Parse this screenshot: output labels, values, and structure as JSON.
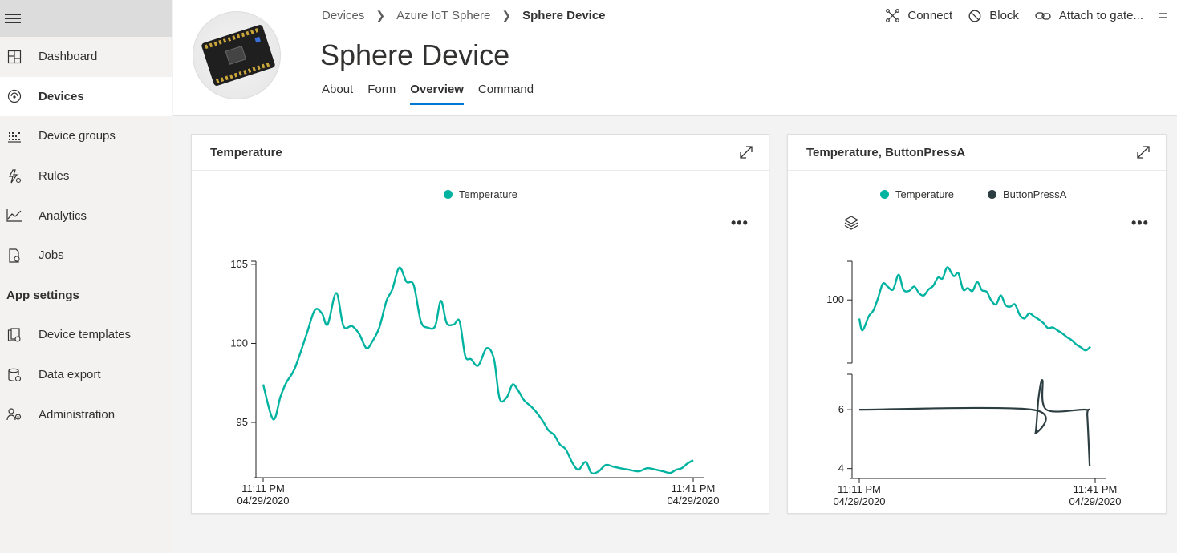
{
  "sidebar": {
    "items": [
      {
        "label": "Dashboard",
        "icon": "dashboard-icon"
      },
      {
        "label": "Devices",
        "icon": "devices-icon",
        "active": true
      },
      {
        "label": "Device groups",
        "icon": "device-groups-icon"
      },
      {
        "label": "Rules",
        "icon": "rules-icon"
      },
      {
        "label": "Analytics",
        "icon": "analytics-icon"
      },
      {
        "label": "Jobs",
        "icon": "jobs-icon"
      }
    ],
    "section_label": "App settings",
    "settings_items": [
      {
        "label": "Device templates",
        "icon": "device-templates-icon"
      },
      {
        "label": "Data export",
        "icon": "data-export-icon"
      },
      {
        "label": "Administration",
        "icon": "administration-icon"
      }
    ]
  },
  "header": {
    "breadcrumb": [
      "Devices",
      "Azure IoT Sphere",
      "Sphere Device"
    ],
    "title": "Sphere Device",
    "tabs": [
      "About",
      "Form",
      "Overview",
      "Command"
    ],
    "active_tab": "Overview",
    "toolbar": {
      "connect_label": "Connect",
      "block_label": "Block",
      "attach_label": "Attach to gate..."
    }
  },
  "colors": {
    "accent": "#0078d4",
    "temperature": "#00b3a0",
    "button_press": "#2d3e42"
  },
  "cards": [
    {
      "title": "Temperature",
      "legend": [
        {
          "name": "Temperature",
          "color": "#00b3a0"
        }
      ]
    },
    {
      "title": "Temperature, ButtonPressA",
      "legend": [
        {
          "name": "Temperature",
          "color": "#00b3a0"
        },
        {
          "name": "ButtonPressA",
          "color": "#2d3e42"
        }
      ]
    }
  ],
  "chart_data": [
    {
      "type": "line",
      "title": "Temperature",
      "x_start": {
        "time": "11:11 PM",
        "date": "04/29/2020"
      },
      "x_end": {
        "time": "11:41 PM",
        "date": "04/29/2020"
      },
      "yticks": [
        95,
        100,
        105
      ],
      "ylim": [
        91.5,
        105.2
      ],
      "series": [
        {
          "name": "Temperature",
          "color": "#00b3a0",
          "x": [
            0,
            0.7,
            1.2,
            1.6,
            2.2,
            3.0,
            3.6,
            4.1,
            4.5,
            5.1,
            5.6,
            6.2,
            6.7,
            7.2,
            7.6,
            8.1,
            8.6,
            9.0,
            9.5,
            10.0,
            10.5,
            11.0,
            11.5,
            12.0,
            12.4,
            12.8,
            13.3,
            13.7,
            14.1,
            14.5,
            15.0,
            15.6,
            16.1,
            16.5,
            17.0,
            17.4,
            17.8,
            18.2,
            18.7,
            19.1,
            19.5,
            19.9,
            20.3,
            20.7,
            21.1,
            21.6,
            22.0,
            22.5,
            22.9,
            23.4,
            23.9,
            24.4,
            24.9,
            25.5,
            26.2,
            26.8,
            27.4,
            27.9,
            28.4,
            28.8,
            29.2,
            29.6,
            30.0
          ],
          "y": [
            97.4,
            95.2,
            96.6,
            97.5,
            98.4,
            100.5,
            102.1,
            101.9,
            101.2,
            103.2,
            101.1,
            101.1,
            100.6,
            99.7,
            100.1,
            101.0,
            102.7,
            103.4,
            104.8,
            103.9,
            103.7,
            101.4,
            101.0,
            101.1,
            102.7,
            101.3,
            101.2,
            101.4,
            99.2,
            99.0,
            98.6,
            99.7,
            99.0,
            96.5,
            96.6,
            97.4,
            97.0,
            96.4,
            96.0,
            95.6,
            95.1,
            94.5,
            94.2,
            93.6,
            93.3,
            92.4,
            92.0,
            92.5,
            91.8,
            91.9,
            92.3,
            92.2,
            92.1,
            92.0,
            91.9,
            92.1,
            92.0,
            91.9,
            91.8,
            92.0,
            92.1,
            92.4,
            92.6
          ]
        }
      ]
    },
    {
      "type": "line",
      "title": "Temperature, ButtonPressA",
      "x_start": {
        "time": "11:11 PM",
        "date": "04/29/2020"
      },
      "x_end": {
        "time": "11:41 PM",
        "date": "04/29/2020"
      },
      "panels": [
        {
          "series_name": "Temperature",
          "yticks": [
            100
          ],
          "ylim": [
            91.5,
            105.2
          ]
        },
        {
          "series_name": "ButtonPressA",
          "yticks": [
            4,
            6
          ],
          "ylim": [
            3.8,
            7.2
          ]
        }
      ],
      "series": [
        {
          "name": "Temperature",
          "color": "#00b3a0",
          "x": [
            0,
            0.4,
            1.2,
            1.8,
            2.4,
            3.0,
            3.6,
            4.3,
            5.0,
            5.6,
            6.3,
            7.0,
            7.6,
            8.2,
            8.8,
            9.4,
            10.0,
            10.6,
            11.2,
            12.0,
            12.6,
            13.2,
            13.8,
            14.4,
            15.0,
            15.6,
            16.2,
            16.8,
            17.4,
            18.0,
            18.6,
            19.2,
            19.8,
            20.4,
            21.0,
            21.6,
            22.2,
            22.8,
            23.4,
            24.0,
            24.6,
            25.2,
            25.8,
            26.4,
            27.0,
            27.6,
            28.2,
            28.8,
            29.4
          ],
          "y": [
            97.5,
            95.9,
            97.8,
            98.6,
            100.3,
            102.2,
            101.8,
            101.4,
            103.4,
            101.4,
            101.2,
            101.8,
            100.9,
            100.6,
            101.4,
            101.9,
            103.0,
            102.9,
            104.4,
            103.2,
            103.6,
            101.4,
            101.6,
            101.2,
            102.4,
            101.3,
            101.1,
            99.9,
            99.4,
            100.6,
            99.3,
            99.1,
            99.4,
            98.0,
            97.5,
            98.2,
            97.8,
            97.4,
            96.9,
            96.2,
            96.3,
            95.9,
            95.5,
            95.0,
            94.6,
            94.0,
            93.6,
            93.2,
            93.7
          ]
        },
        {
          "name": "ButtonPressA",
          "color": "#2d3e42",
          "x": [
            0,
            22.0,
            22.4,
            22.8,
            23.3,
            23.8,
            28.8,
            29.0,
            29.3
          ],
          "y": [
            6,
            6,
            5.2,
            6.4,
            7.0,
            6.0,
            6.0,
            5.8,
            4.1
          ]
        }
      ]
    }
  ]
}
